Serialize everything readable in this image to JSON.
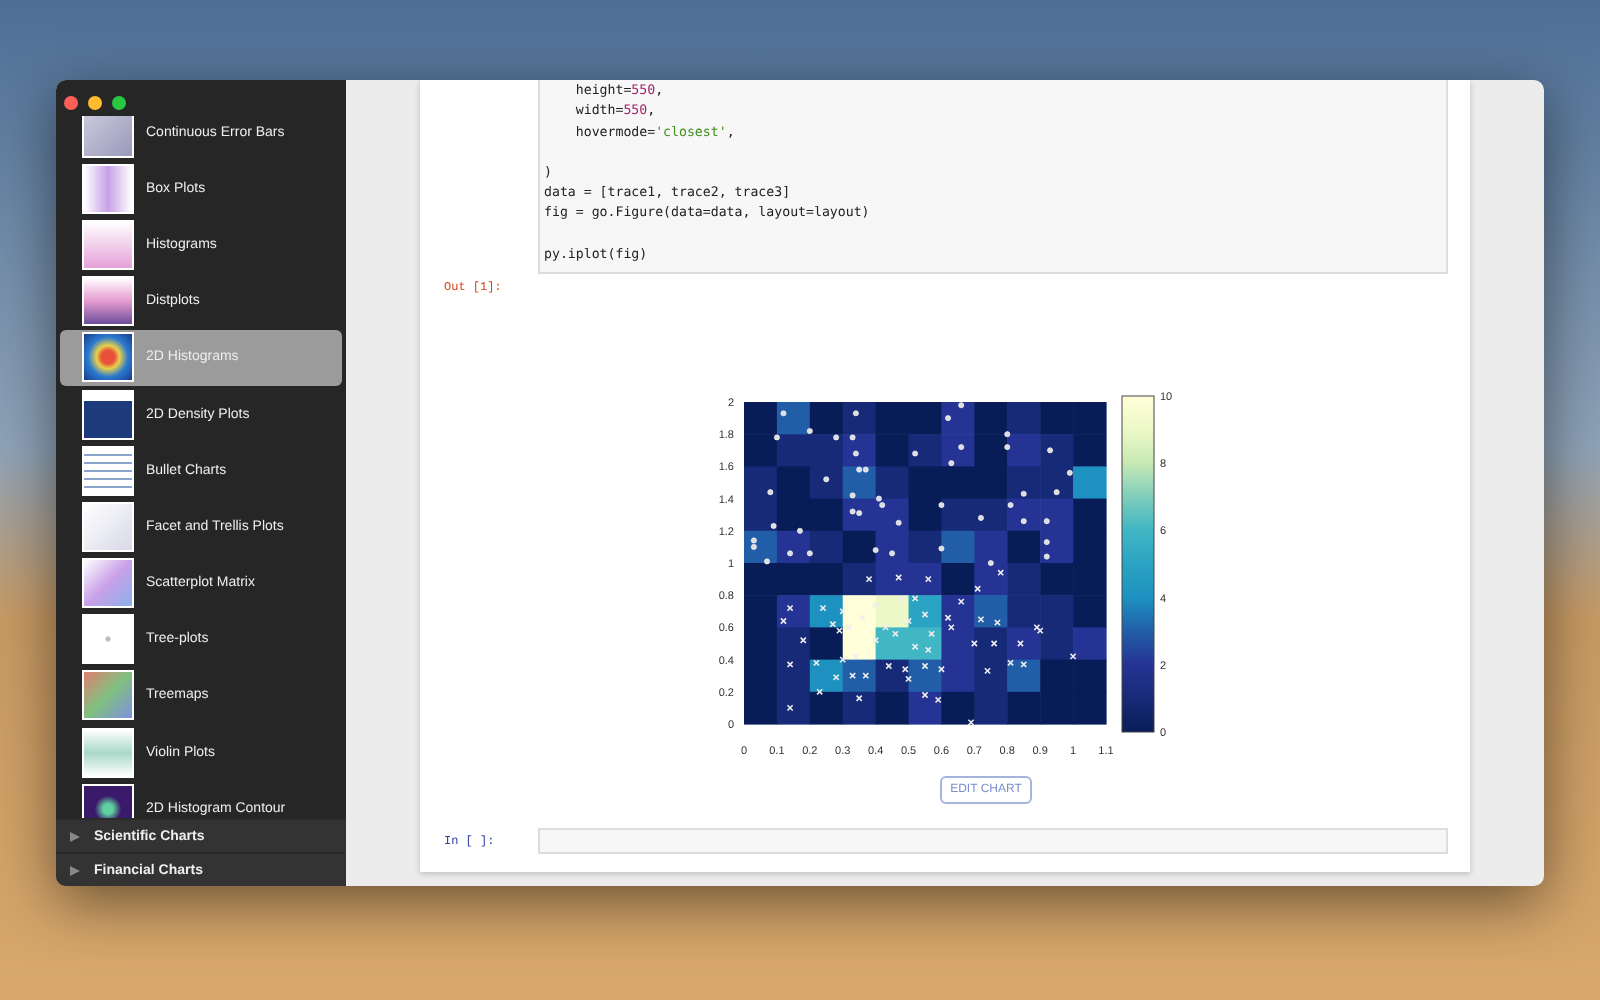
{
  "sidebar": {
    "items": [
      {
        "label": "Continuous Error Bars",
        "selected": false
      },
      {
        "label": "Box Plots",
        "selected": false
      },
      {
        "label": "Histograms",
        "selected": false
      },
      {
        "label": "Distplots",
        "selected": false
      },
      {
        "label": "2D Histograms",
        "selected": true
      },
      {
        "label": "2D Density Plots",
        "selected": false
      },
      {
        "label": "Bullet Charts",
        "selected": false
      },
      {
        "label": "Facet and Trellis Plots",
        "selected": false
      },
      {
        "label": "Scatterplot Matrix",
        "selected": false
      },
      {
        "label": "Tree-plots",
        "selected": false
      },
      {
        "label": "Treemaps",
        "selected": false
      },
      {
        "label": "Violin Plots",
        "selected": false
      },
      {
        "label": "2D Histogram Contour",
        "selected": false
      }
    ],
    "groups": [
      {
        "label": "Scientific Charts",
        "expanded": false
      },
      {
        "label": "Financial Charts",
        "expanded": false
      }
    ]
  },
  "notebook": {
    "code_lines": [
      {
        "gap_before": false,
        "tokens": [
          {
            "text": "    height=",
            "kind": "plain"
          },
          {
            "text": "550",
            "kind": "number"
          },
          {
            "text": ",",
            "kind": "plain"
          }
        ]
      },
      {
        "gap_before": false,
        "tokens": [
          {
            "text": "    width=",
            "kind": "plain"
          },
          {
            "text": "550",
            "kind": "number"
          },
          {
            "text": ",",
            "kind": "plain"
          }
        ]
      },
      {
        "gap_before": false,
        "tokens": [
          {
            "text": "    hovermode=",
            "kind": "plain"
          },
          {
            "text": "'closest'",
            "kind": "string"
          },
          {
            "text": ",",
            "kind": "plain"
          }
        ]
      },
      {
        "gap_before": true,
        "tokens": [
          {
            "text": ")",
            "kind": "plain"
          }
        ]
      },
      {
        "gap_before": false,
        "tokens": [
          {
            "text": "data = [trace1, trace2, trace3]",
            "kind": "plain"
          }
        ]
      },
      {
        "gap_before": false,
        "tokens": [
          {
            "text": "fig = go.Figure(data=data, layout=layout)",
            "kind": "plain"
          }
        ]
      },
      {
        "gap_before": true,
        "tokens": [
          {
            "text": "py.iplot(fig)",
            "kind": "plain"
          }
        ]
      }
    ],
    "output_prompt": "Out [1]:",
    "chart": {
      "yticks": [
        "2",
        "1.8",
        "1.6",
        "1.4",
        "1.2",
        "1",
        "0.8",
        "0.6",
        "0.4",
        "0.2",
        "0"
      ],
      "xticks": [
        "0",
        "0.1",
        "0.2",
        "0.3",
        "0.4",
        "0.5",
        "0.6",
        "0.7",
        "0.8",
        "0.9",
        "1",
        "1.1"
      ],
      "colorbar_ticks": [
        "10",
        "8",
        "6",
        "4",
        "2",
        "0"
      ]
    },
    "edit_button": "EDIT CHART",
    "input_prompt": "In [ ]:"
  }
}
